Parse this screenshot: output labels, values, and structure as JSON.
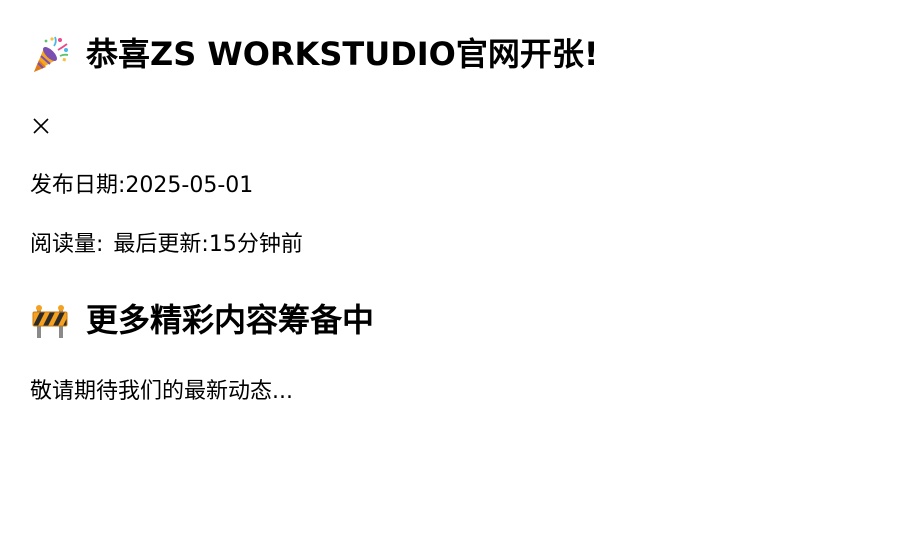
{
  "announcement": {
    "title": "恭喜ZS WORKSTUDIO官网开张!",
    "title_icon": "party-popper-icon",
    "close_glyph": "×",
    "date_label": "发布日期:",
    "date_value": "2025-05-01",
    "read_count_label": "阅读量:",
    "read_count_value": "",
    "last_updated_label": "最后更新:",
    "last_updated_value": "15分钟前"
  },
  "coming_soon": {
    "title": "更多精彩内容筹备中",
    "title_icon": "construction-barrier-icon",
    "message": "敬请期待我们的最新动态..."
  },
  "colors": {
    "text": "#000000",
    "background": "#ffffff",
    "construction_orange": "#f4a020",
    "construction_black": "#2b2b2b",
    "popper_purple": "#7b4fb0",
    "popper_yellow": "#f5c242"
  }
}
